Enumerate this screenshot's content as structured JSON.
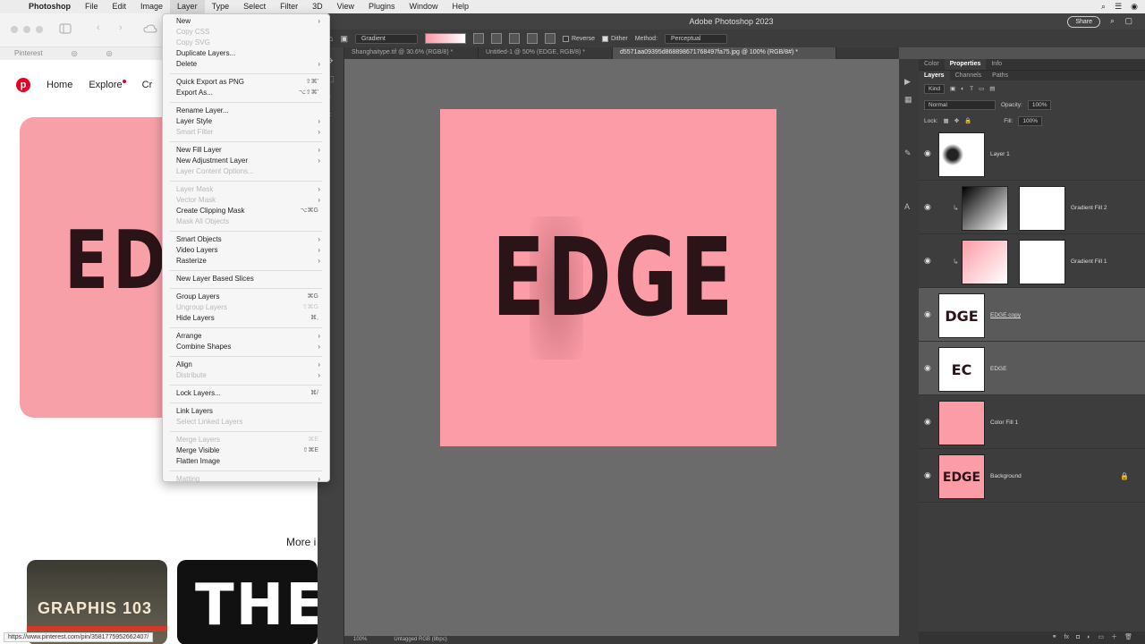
{
  "menubar": {
    "app": "Photoshop",
    "items": [
      "File",
      "Edit",
      "Image",
      "Layer",
      "Type",
      "Select",
      "Filter",
      "3D",
      "View",
      "Plugins",
      "Window",
      "Help"
    ]
  },
  "browser": {
    "tabs": [
      "Pinterest"
    ],
    "nav": {
      "home": "Home",
      "explore": "Explore",
      "create": "Cr"
    },
    "card_text": "EDGE",
    "more_label": "More i",
    "thumb1_text": "GRAPHIS 103",
    "thumb2_text": "THE",
    "status_url": "https://www.pinterest.com/pin/3581775952662407/"
  },
  "photoshop": {
    "window_title": "Adobe Photoshop 2023",
    "options": {
      "tool_preset": "Gradient",
      "reverse": "Reverse",
      "dither": "Dither",
      "method_label": "Method:",
      "method": "Perceptual"
    },
    "share": "Share",
    "doc_tabs": [
      "Shanghaitype.tif @ 30.6% (RGB/8) *",
      "Untitled-1 @ 50% (EDGE, RGB/8) *",
      "d5571aa09395d868898671768497fa75.jpg @ 100% (RGB/8#) *"
    ],
    "canvas_text": "EDGE",
    "status": {
      "zoom": "100%",
      "profile": "Untagged RGB (8bpc)"
    }
  },
  "panels": {
    "tabs_top": [
      "Color",
      "Properties",
      "Info"
    ],
    "tabs_layers": [
      "Layers",
      "Channels",
      "Paths"
    ],
    "kind": "Kind",
    "blend_mode": "Normal",
    "opacity_label": "Opacity:",
    "opacity": "100%",
    "lock_label": "Lock:",
    "fill_label": "Fill:",
    "fill": "100%",
    "layers": [
      {
        "name": "Layer 1"
      },
      {
        "name": "Gradient Fill 2"
      },
      {
        "name": "Gradient Fill 1"
      },
      {
        "name": "EDGE copy",
        "thumb": "DGE"
      },
      {
        "name": "EDGE",
        "thumb": "EC"
      },
      {
        "name": "Color Fill 1"
      },
      {
        "name": "Background",
        "thumb": "EDGE"
      }
    ]
  },
  "layer_menu": {
    "new": "New",
    "copy_css": "Copy CSS",
    "copy_svg": "Copy SVG",
    "duplicate": "Duplicate Layers...",
    "delete": "Delete",
    "quick_export": "Quick Export as PNG",
    "quick_export_sc": "⇧⌘'",
    "export_as": "Export As...",
    "export_as_sc": "⌥⇧⌘'",
    "rename": "Rename Layer...",
    "layer_style": "Layer Style",
    "smart_filter": "Smart Filter",
    "new_fill": "New Fill Layer",
    "new_adjust": "New Adjustment Layer",
    "content_options": "Layer Content Options...",
    "layer_mask": "Layer Mask",
    "vector_mask": "Vector Mask",
    "clipping_mask": "Create Clipping Mask",
    "clipping_mask_sc": "⌥⌘G",
    "mask_all": "Mask All Objects",
    "smart_objects": "Smart Objects",
    "video_layers": "Video Layers",
    "rasterize": "Rasterize",
    "new_slices": "New Layer Based Slices",
    "group": "Group Layers",
    "group_sc": "⌘G",
    "ungroup": "Ungroup Layers",
    "ungroup_sc": "⇧⌘G",
    "hide": "Hide Layers",
    "hide_sc": "⌘,",
    "arrange": "Arrange",
    "combine": "Combine Shapes",
    "align": "Align",
    "distribute": "Distribute",
    "lock": "Lock Layers...",
    "lock_sc": "⌘/",
    "link": "Link Layers",
    "select_linked": "Select Linked Layers",
    "merge": "Merge Layers",
    "merge_sc": "⌘E",
    "merge_visible": "Merge Visible",
    "merge_visible_sc": "⇧⌘E",
    "flatten": "Flatten Image",
    "matting": "Matting"
  }
}
